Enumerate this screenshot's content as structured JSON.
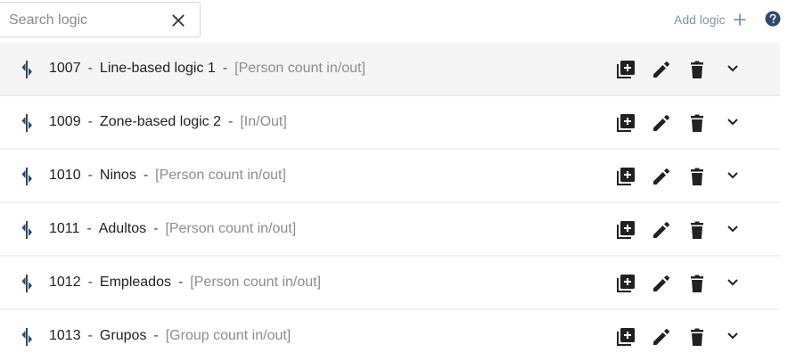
{
  "search": {
    "placeholder": "Search logic",
    "value": ""
  },
  "toolbar": {
    "add_label": "Add logic",
    "accent_color": "#7b97ad"
  },
  "help": {
    "icon": "help-circle-icon",
    "color": "#2f4b6b"
  },
  "logics": [
    {
      "id": "1007",
      "name": "Line-based logic 1",
      "type": "[Person count in/out]"
    },
    {
      "id": "1009",
      "name": "Zone-based logic 2",
      "type": "[In/Out]"
    },
    {
      "id": "1010",
      "name": "Ninos",
      "type": "[Person count in/out]"
    },
    {
      "id": "1011",
      "name": "Adultos",
      "type": "[Person count in/out]"
    },
    {
      "id": "1012",
      "name": "Empleados",
      "type": "[Person count in/out]"
    },
    {
      "id": "1013",
      "name": "Grupos",
      "type": "[Group count in/out]"
    }
  ],
  "row_separator": "-",
  "row_icons": {
    "logic": "line-crossing-icon",
    "add": "add-box-icon",
    "edit": "pencil-icon",
    "delete": "trash-icon",
    "expand": "chevron-down-icon"
  }
}
